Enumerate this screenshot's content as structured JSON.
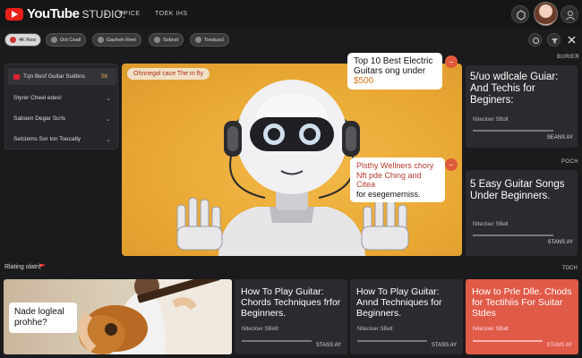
{
  "header": {
    "brand": "YouTube",
    "studio": "STUDIO:",
    "separator": "•",
    "nav": [
      "PPICE",
      "TOEK IHS"
    ]
  },
  "filters": [
    "4K Rosi",
    "Oot Ceatl",
    "Gaoheh Reet",
    "Sobnst",
    "Toeduscl"
  ],
  "sidebar": {
    "items": [
      {
        "label": "Tqn Besf Guitar Suitbns",
        "badge": "S8"
      },
      {
        "label": "Styrer Cheel edes!"
      },
      {
        "label": "Saboen Degar Scrls"
      },
      {
        "label": "Setciems Sor ton Toecatly"
      }
    ]
  },
  "hero": {
    "pill": "Ohnnegal cace The m fty",
    "bubble1": {
      "line1": "Top 10 Best Electric",
      "line2": "Guitars ong under",
      "price": "$500"
    },
    "bubble2": {
      "line1": "Plsthy Wellners chory",
      "line2": "Nft pde Ching and Citea",
      "line3": "for esegemerniss."
    }
  },
  "right_rail": {
    "label_top": "BURIER",
    "card1": {
      "title": "5/uo wdlcale Guiar: And Techis for Beginers:",
      "meta": "Nitecloer SBolt",
      "stat": "SEANS AY"
    },
    "label_mid": "POCH",
    "card2": {
      "title": "5 Easy Guitar Songs Under Beginners.",
      "meta": "Nitecloer SBelt",
      "stat": "STANS AY"
    }
  },
  "bottom": {
    "section_title": "Rlating olatri",
    "section_flag": "🚩",
    "section_right": "TOCH",
    "guitar_caption": "Nade logleal prohhe?",
    "cards": [
      {
        "title": "How To Play Guitar: Chords Techniques frfor Beginners.",
        "meta": "Nitecloer SBelit",
        "stat": "STASS AY"
      },
      {
        "title": "How To Play Guitar: Annd Techniques for Beginners.",
        "meta": "Nitecloer SBelt",
        "stat": "STASS AY"
      },
      {
        "title": "How to Prle Dlle. Chods for Tectihiis For Suitar Stdes",
        "meta": "Nitecloer SBalt",
        "stat": "STANS AY"
      }
    ]
  },
  "colors": {
    "accent_red": "#e62117",
    "hero_bg": "#e9a834",
    "card_red": "#e05a48",
    "price_orange": "#d9731c"
  }
}
